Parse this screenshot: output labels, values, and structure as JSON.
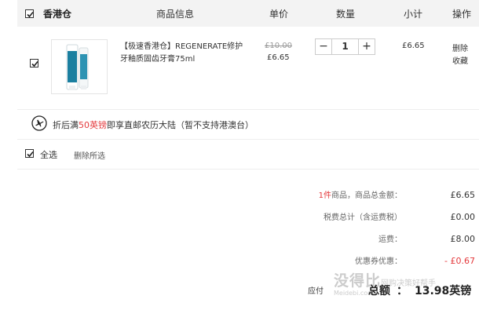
{
  "header": {
    "store": "香港仓",
    "cols": {
      "info": "商品信息",
      "price": "单价",
      "qty": "数量",
      "subtotal": "小计",
      "ops": "操作"
    }
  },
  "item": {
    "name_line1": "【极速香港仓】REGENERATE修护",
    "name_line2": "牙釉质固齿牙膏75ml",
    "price_old": "£10.00",
    "price": "£6.65",
    "quantity": "1",
    "subtotal": "£6.65",
    "delete": "删除",
    "favorite": "收藏",
    "brand_text": "REGENERATE"
  },
  "promo": {
    "prefix": "折后满",
    "highlight": "50英镑",
    "suffix": "即享直邮农历大陆（暂不支持港澳台）"
  },
  "select_bar": {
    "select_all": "全选",
    "delete_selected": "删除所选"
  },
  "summary": {
    "count": "1件",
    "count_label": "商品，商品总金额：",
    "goods_total": "£6.65",
    "tax_label": "税费总计（含运费税）",
    "tax": "£0.00",
    "shipping_label": "运费：",
    "shipping": "£8.00",
    "coupon_label": "优惠券优惠：",
    "coupon": "- £0.67",
    "pay_label": "应付",
    "total_label": "总额",
    "colon": "：",
    "total": "13.98英镑"
  },
  "watermark": {
    "line1": "没得比",
    "line2": "Meidebi.com",
    "line3": "网购决策好帮手"
  },
  "colors": {
    "accent": "#e4393c",
    "header_bg": "#f3f3f3"
  }
}
